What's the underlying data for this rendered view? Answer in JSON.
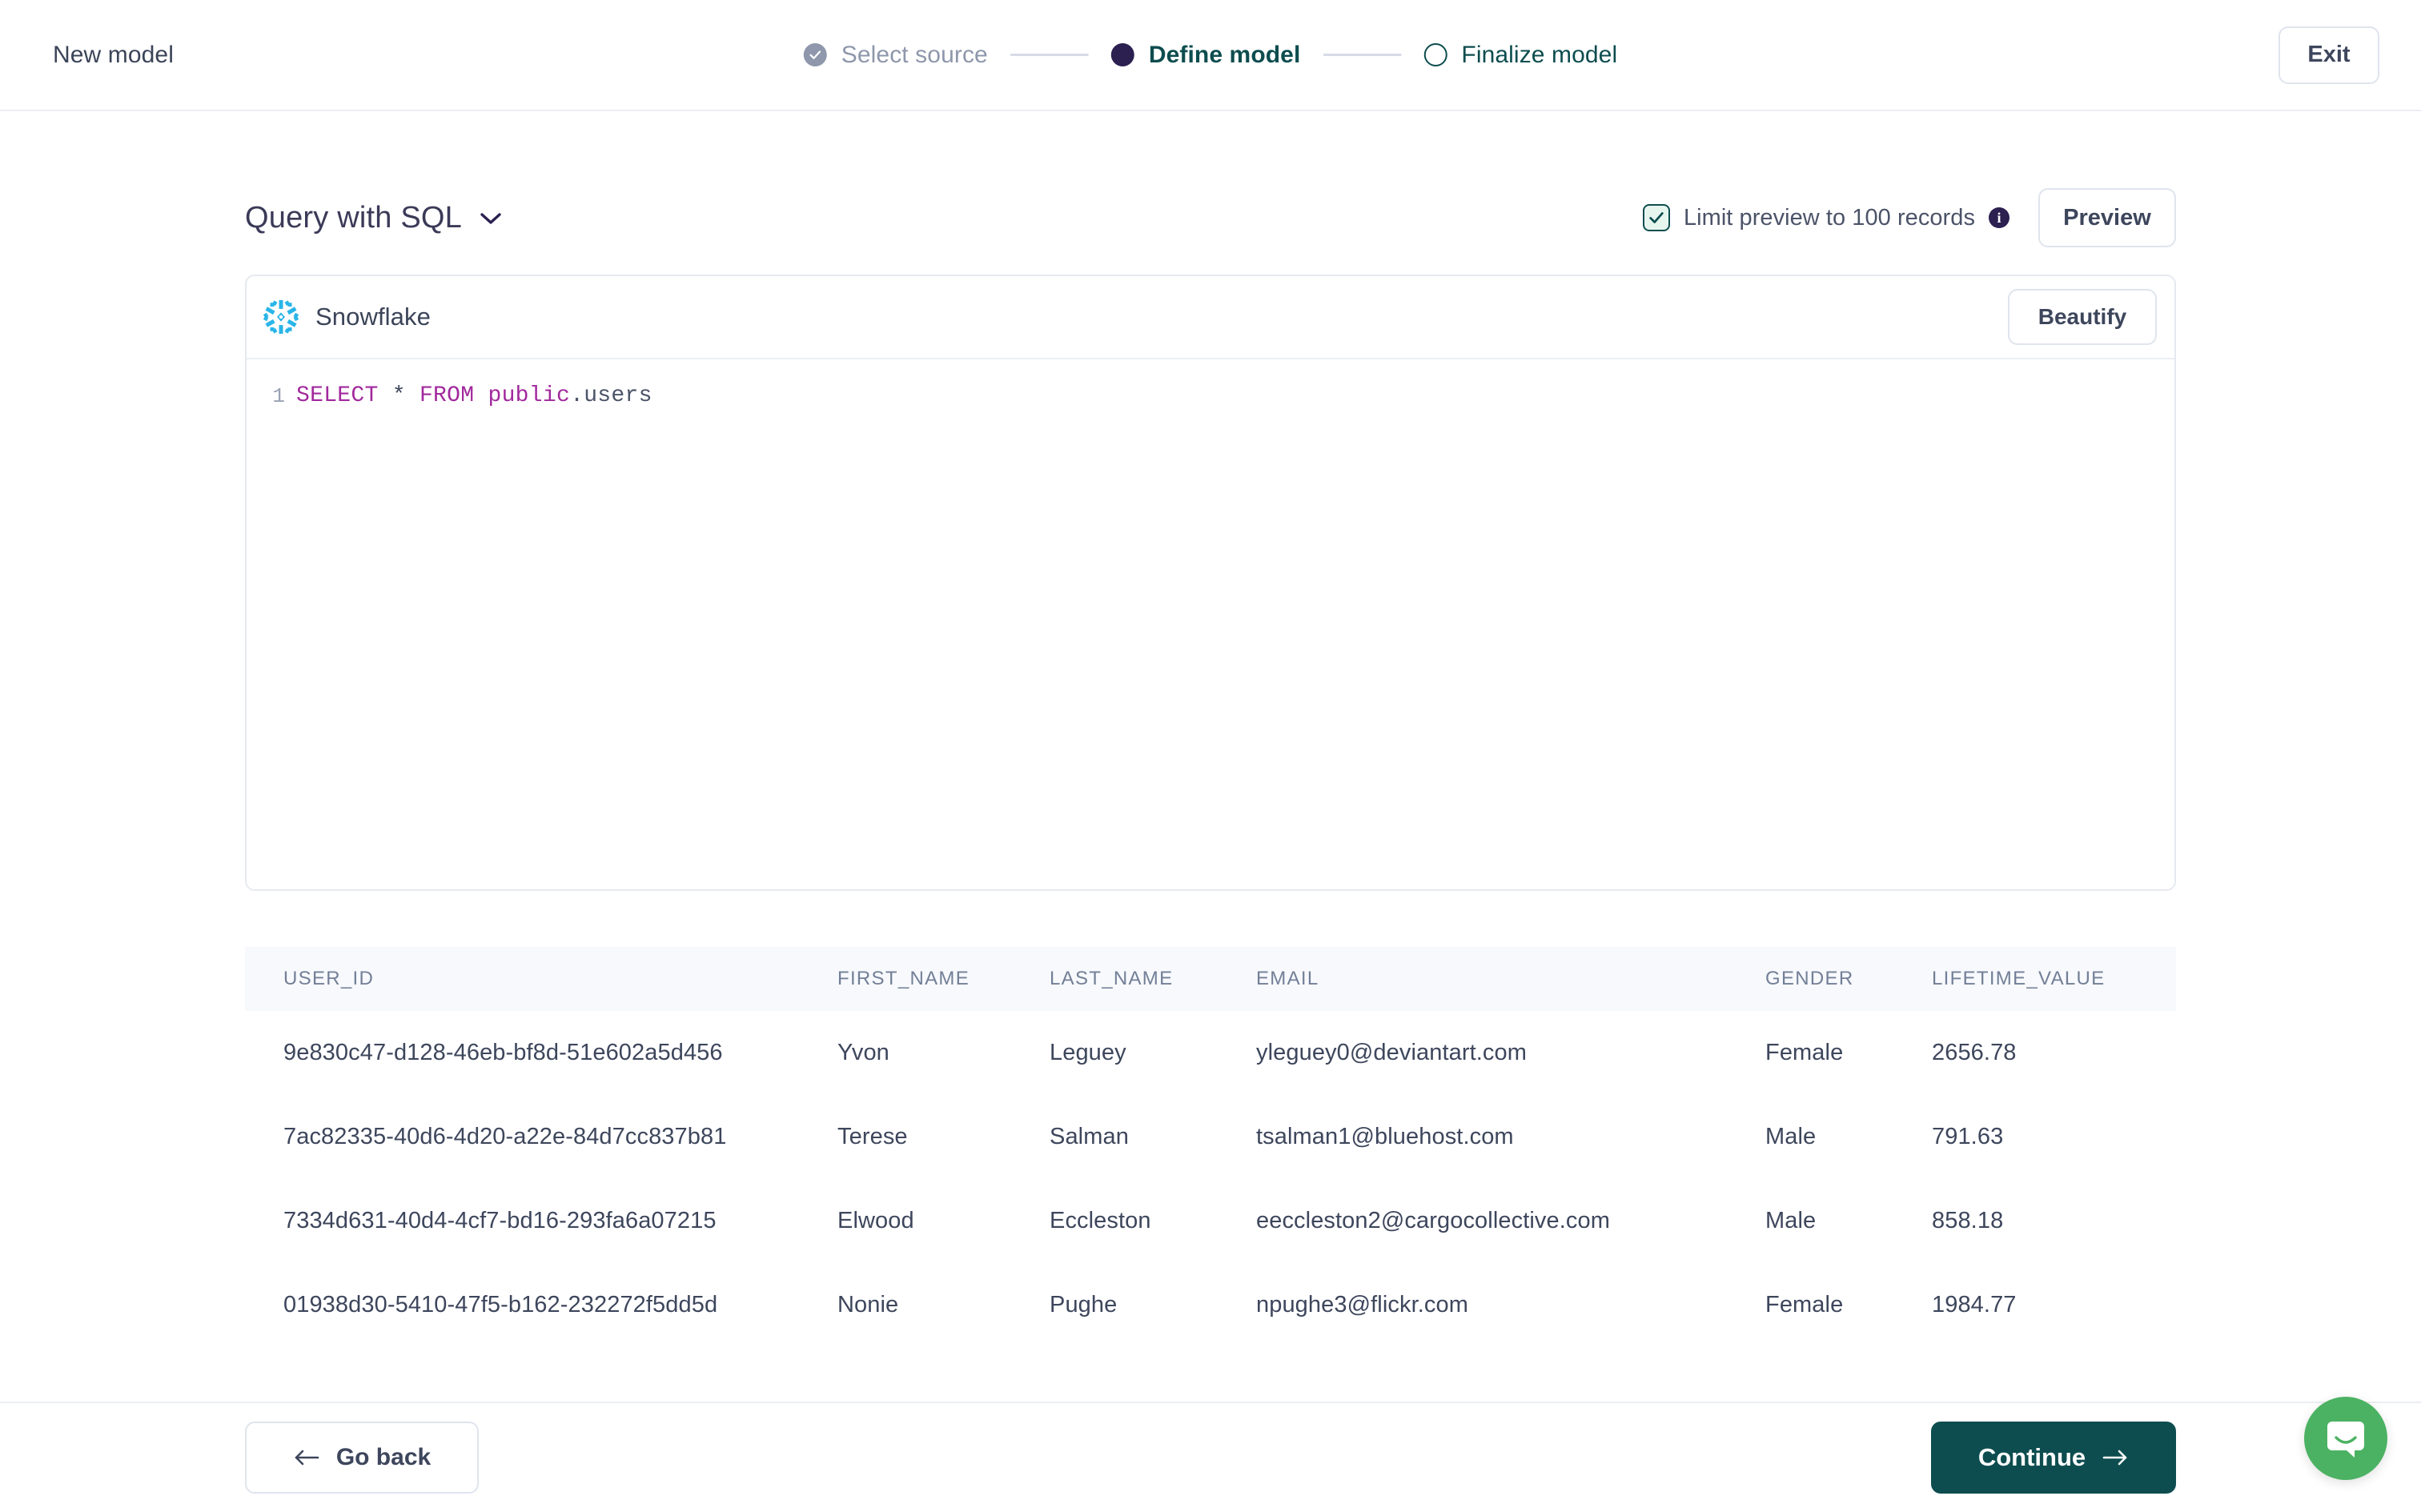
{
  "topbar": {
    "app_title": "New model",
    "exit_label": "Exit",
    "steps": [
      {
        "label": "Select source",
        "state": "done",
        "marker_icon": "check-circle-icon"
      },
      {
        "label": "Define model",
        "state": "active",
        "marker_icon": "filled-circle-icon"
      },
      {
        "label": "Finalize model",
        "state": "todo",
        "marker_icon": "empty-circle-icon"
      }
    ]
  },
  "query_header": {
    "mode_label": "Query with SQL",
    "mode_chevron_icon": "chevron-down-icon",
    "limit_label": "Limit preview to 100 records",
    "limit_checked": true,
    "info_icon_glyph": "i",
    "preview_label": "Preview"
  },
  "editor": {
    "source_name": "Snowflake",
    "source_icon": "snowflake-icon",
    "beautify_label": "Beautify",
    "line_number": "1",
    "sql_tokens": {
      "select": "SELECT",
      "star": " * ",
      "from": "FROM",
      "space": " ",
      "schema": "public",
      "table": ".users"
    },
    "sql_text": "SELECT * FROM public.users"
  },
  "results": {
    "columns": [
      "USER_ID",
      "FIRST_NAME",
      "LAST_NAME",
      "EMAIL",
      "GENDER",
      "LIFETIME_VALUE"
    ],
    "rows": [
      {
        "user_id": "9e830c47-d128-46eb-bf8d-51e602a5d456",
        "first_name": "Yvon",
        "last_name": "Leguey",
        "email": "yleguey0@deviantart.com",
        "gender": "Female",
        "lifetime_value": "2656.78"
      },
      {
        "user_id": "7ac82335-40d6-4d20-a22e-84d7cc837b81",
        "first_name": "Terese",
        "last_name": "Salman",
        "email": "tsalman1@bluehost.com",
        "gender": "Male",
        "lifetime_value": "791.63"
      },
      {
        "user_id": "7334d631-40d4-4cf7-bd16-293fa6a07215",
        "first_name": "Elwood",
        "last_name": "Eccleston",
        "email": "eeccleston2@cargocollective.com",
        "gender": "Male",
        "lifetime_value": "858.18"
      },
      {
        "user_id": "01938d30-5410-47f5-b162-232272f5dd5d",
        "first_name": "Nonie",
        "last_name": "Pughe",
        "email": "npughe3@flickr.com",
        "gender": "Female",
        "lifetime_value": "1984.77"
      }
    ]
  },
  "footer": {
    "go_back_label": "Go back",
    "go_back_icon": "arrow-left-icon",
    "continue_label": "Continue",
    "continue_icon": "arrow-right-icon"
  },
  "support": {
    "launcher_icon": "chat-bubble-icon"
  },
  "colors": {
    "brand_dark_teal": "#0d4d4f",
    "step_active": "#2b2050",
    "step_done": "#8e97ab",
    "snowflake_blue": "#29b5e8",
    "checkbox_fill": "#e7f5ef",
    "sql_keyword": "#a1289c",
    "table_header_bg": "#f7f9fc",
    "intercom_green": "#4cb263",
    "border": "#e6e9f0"
  }
}
